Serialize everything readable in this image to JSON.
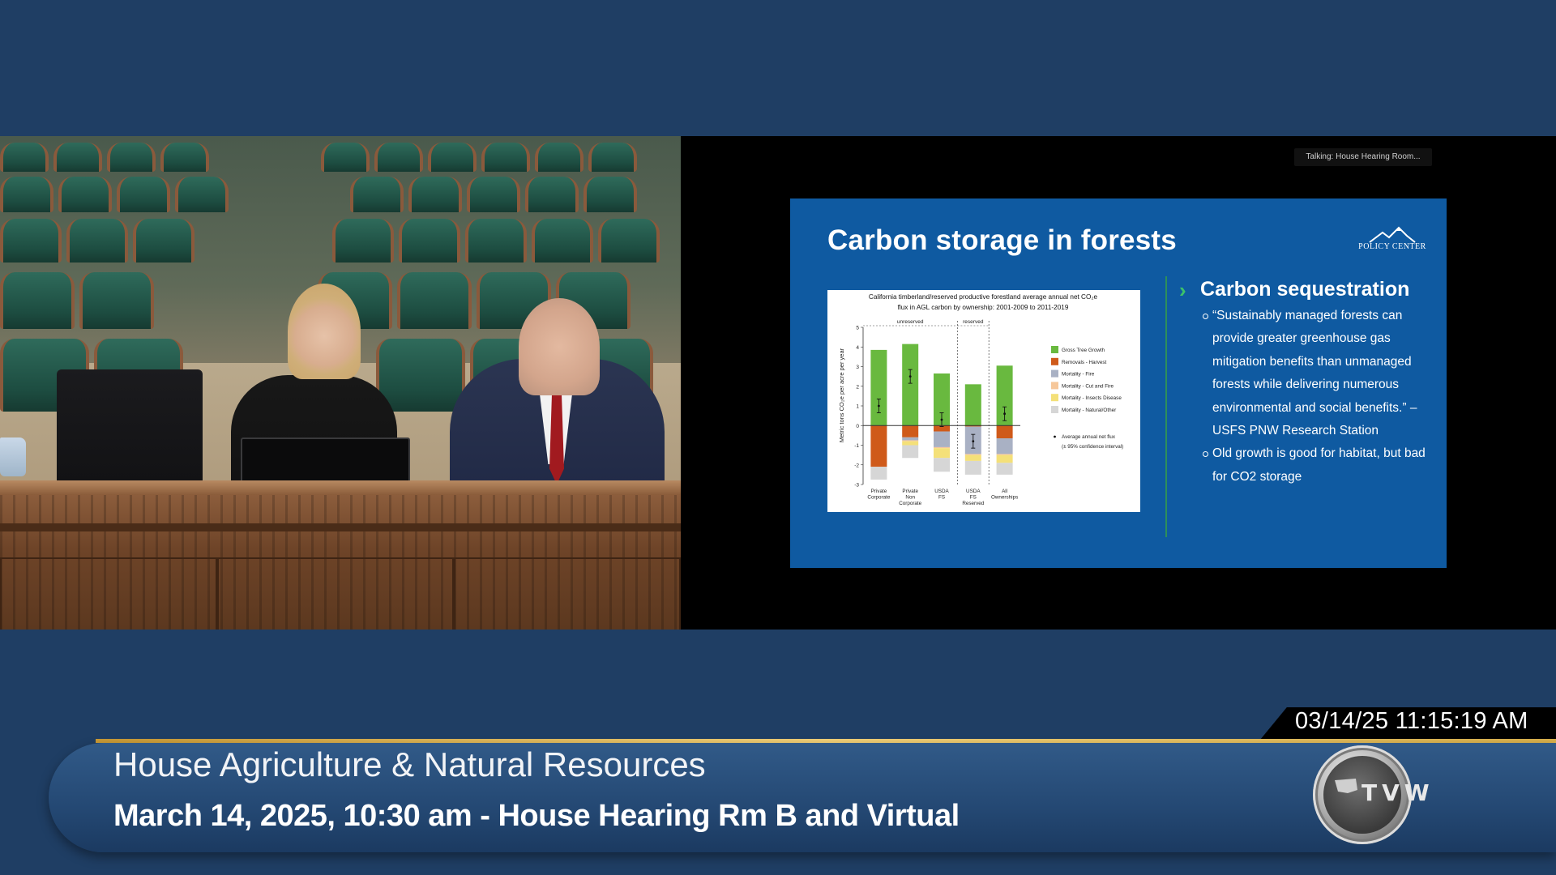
{
  "stream": {
    "talking_indicator": "Talking: House Hearing Room...",
    "timestamp": "03/14/25 11:15:19 AM"
  },
  "slide": {
    "title": "Carbon storage in forests",
    "logo_text": "POLICY CENTER",
    "section_heading": "Carbon sequestration",
    "bullets": [
      "“Sustainably managed forests can provide greater greenhouse gas mitigation benefits than unmanaged forests while delivering numerous environmental and social benefits.” – USFS PNW Research Station",
      "Old growth is good for habitat, but bad for CO2 storage"
    ],
    "colors": {
      "slide_bg": "#0f5aa1",
      "accent_green": "#3cc26a"
    }
  },
  "chart_data": {
    "type": "bar",
    "stacked": true,
    "title": "California timberland/reserved productive forestland average annual net CO₂e flux in AGL carbon by ownership: 2001-2009 to 2011-2019",
    "ylabel": "Metric tons CO₂e per acre per year",
    "ylim": [
      -3,
      5
    ],
    "yticks": [
      "5",
      "4",
      "3",
      "2",
      "1",
      "0",
      "-1",
      "-2",
      "-3"
    ],
    "group_labels": [
      "unreserved",
      "reserved"
    ],
    "categories": [
      "Private Corporate",
      "Private Non Corporate",
      "USDA FS",
      "USDA FS Reserved",
      "All Ownerships"
    ],
    "series": [
      {
        "name": "Gross Tree Growth",
        "color": "#69b93f",
        "values": [
          3.85,
          4.15,
          2.65,
          2.1,
          3.05
        ]
      },
      {
        "name": "Removals - Harvest",
        "color": "#cf5a1a",
        "values": [
          -2.1,
          -0.6,
          -0.3,
          -0.05,
          -0.65
        ]
      },
      {
        "name": "Mortality - Fire",
        "color": "#a9b1c4",
        "values": [
          0,
          -0.15,
          -0.8,
          -1.4,
          -0.8
        ]
      },
      {
        "name": "Mortality - Cut and Fire",
        "color": "#f6c79a",
        "values": [
          0,
          -0.05,
          -0.05,
          -0.05,
          -0.05
        ]
      },
      {
        "name": "Mortality - Insects Disease",
        "color": "#f4e079",
        "values": [
          0,
          -0.2,
          -0.5,
          -0.3,
          -0.4
        ]
      },
      {
        "name": "Mortality - Natural/Other",
        "color": "#d6d6d6",
        "values": [
          -0.65,
          -0.65,
          -0.7,
          -0.7,
          -0.6
        ]
      }
    ],
    "net_flux": [
      1.0,
      2.5,
      0.3,
      -0.8,
      0.6
    ],
    "legend_note": "Average annual net flux (± 95% confidence interval)"
  },
  "chart_text": {
    "title_line1": "California timberland/reserved productive forestland average annual net CO₂e",
    "title_line2": "flux in AGL carbon by ownership: 2001-2009 to 2011-2019",
    "legend_note_line1": "Average annual net flux",
    "legend_note_line2": "(± 95% confidence interval)",
    "cat_lines": [
      [
        "Private",
        "Corporate"
      ],
      [
        "Private",
        "Non",
        "Corporate"
      ],
      [
        "USDA",
        "FS"
      ],
      [
        "USDA",
        "FS",
        "Reserved"
      ],
      [
        "All",
        "Ownerships"
      ]
    ]
  },
  "lower_third": {
    "title": "House Agriculture & Natural Resources",
    "subtitle": "March 14, 2025, 10:30 am - House Hearing Rm B and Virtual",
    "logo_text": "TVW",
    "colors": {
      "banner": "#244873",
      "gold": "#e6bf5a"
    }
  }
}
